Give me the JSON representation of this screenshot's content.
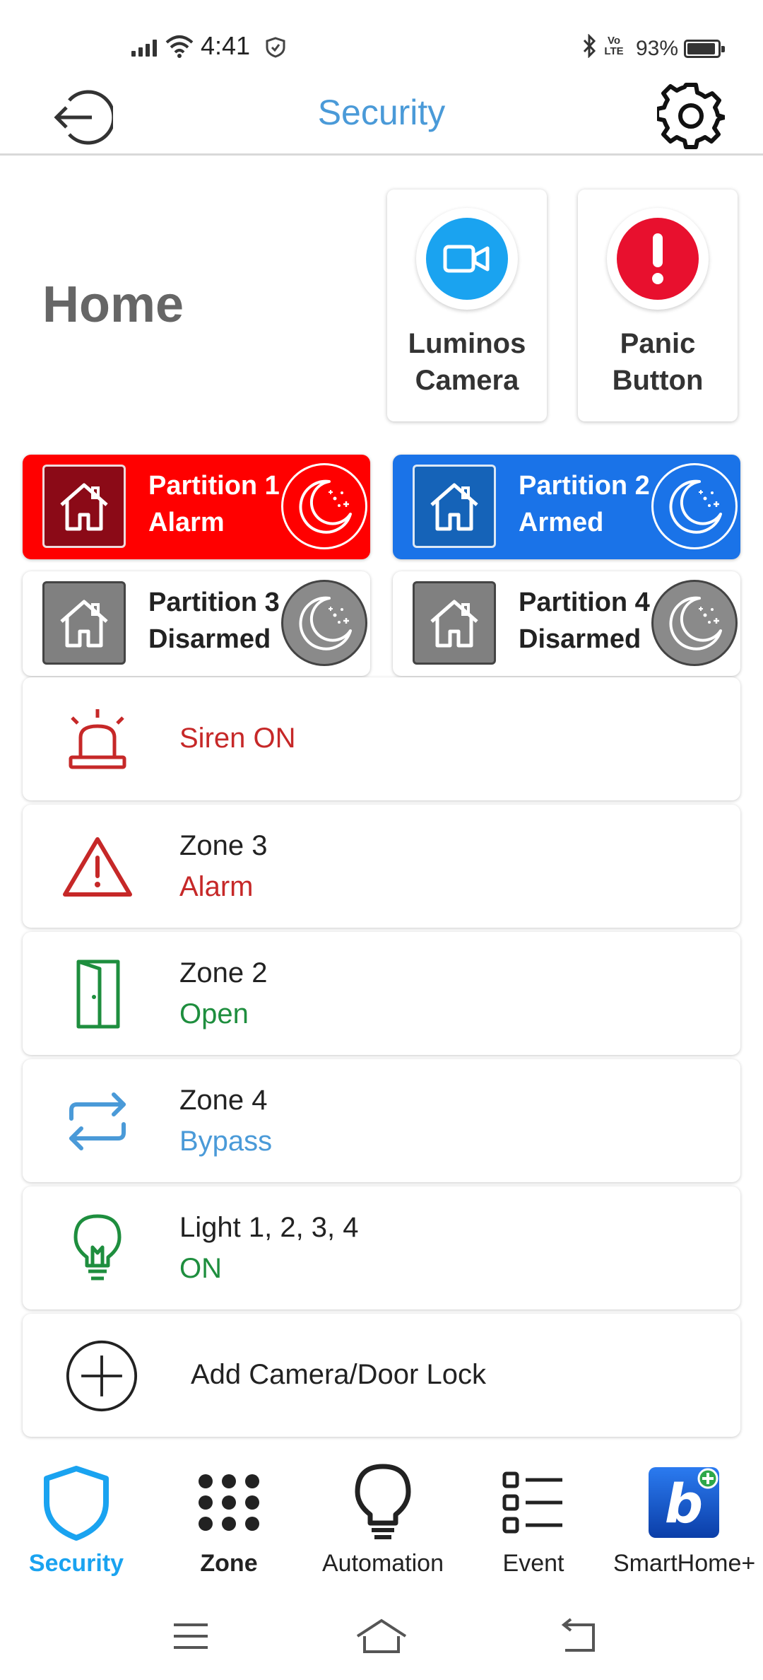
{
  "status_bar": {
    "time": "4:41",
    "battery": "93%",
    "volte": "Vo LTE",
    "battery_level": 0.93
  },
  "header": {
    "title": "Security",
    "back_icon": "logout-icon",
    "settings_icon": "gear-icon"
  },
  "home": {
    "title": "Home",
    "quick_actions": [
      {
        "label": "Luminos Camera",
        "icon": "video-camera-icon",
        "color": "#1aa3f0"
      },
      {
        "label": "Panic Button",
        "icon": "exclamation-icon",
        "color": "#e8102e"
      }
    ]
  },
  "partitions": [
    {
      "name": "Partition 1",
      "status": "Alarm",
      "bg": "#ff0000",
      "tile": "#8b0a17",
      "text_color": "#ffffff"
    },
    {
      "name": "Partition 2",
      "status": "Armed",
      "bg": "#1a73e8",
      "tile": "#1563b8",
      "text_color": "#ffffff"
    },
    {
      "name": "Partition 3",
      "status": "Disarmed",
      "bg": "#ffffff",
      "tile": "#808080",
      "text_color": "#222222"
    },
    {
      "name": "Partition 4",
      "status": "Disarmed",
      "bg": "#ffffff",
      "tile": "#808080",
      "text_color": "#222222"
    }
  ],
  "events": [
    {
      "title": "Siren ON",
      "icon": "siren-icon",
      "color": "#c62828"
    },
    {
      "title": "Zone 3",
      "status": "Alarm",
      "icon": "warning-icon",
      "color": "#c62828"
    },
    {
      "title": "Zone 2",
      "status": "Open",
      "icon": "door-icon",
      "color": "#1e8e3e"
    },
    {
      "title": "Zone 4",
      "status": "Bypass",
      "icon": "bypass-icon",
      "color": "#4a9ad8"
    },
    {
      "title": "Light 1, 2, 3, 4",
      "status": "ON",
      "icon": "lightbulb-icon",
      "color": "#1e8e3e"
    }
  ],
  "add_item": {
    "label": "Add Camera/Door Lock",
    "icon": "plus-circle-icon"
  },
  "bottom_nav": [
    {
      "label": "Security",
      "icon": "shield-icon",
      "active": true
    },
    {
      "label": "Zone",
      "icon": "grid-dots-icon",
      "active": false
    },
    {
      "label": "Automation",
      "icon": "lightbulb-outline-icon",
      "active": false
    },
    {
      "label": "Event",
      "icon": "list-icon",
      "active": false
    },
    {
      "label": "SmartHome+",
      "icon": "smarthome-app-icon",
      "active": false
    }
  ],
  "colors": {
    "accent": "#1aa3f0",
    "title_blue": "#4a9ad8"
  }
}
